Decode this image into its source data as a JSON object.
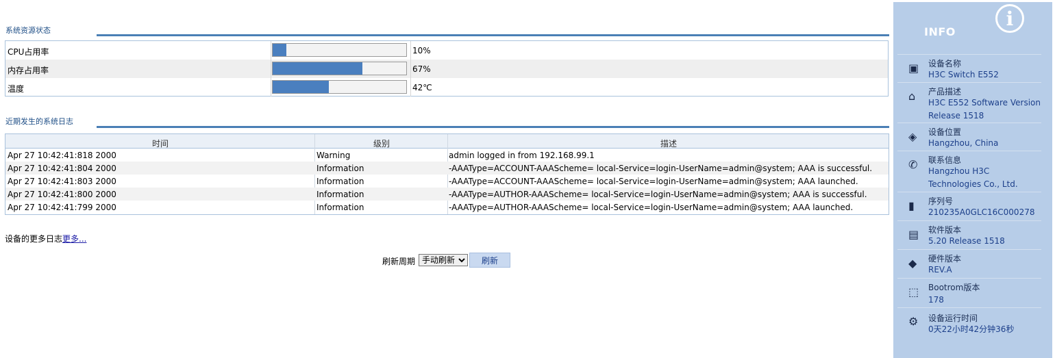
{
  "resource": {
    "title": "系统资源状态",
    "rows": [
      {
        "label": "CPU占用率",
        "value": "10%",
        "percent": 10
      },
      {
        "label": "内存占用率",
        "value": "67%",
        "percent": 67
      },
      {
        "label": "温度",
        "value": "42℃",
        "percent": 42
      }
    ]
  },
  "logs": {
    "title": "近期发生的系统日志",
    "headers": {
      "time": "时间",
      "level": "级别",
      "desc": "描述"
    },
    "rows": [
      {
        "time": "Apr 27 10:42:41:818 2000",
        "level": "Warning",
        "desc": "admin logged in from 192.168.99.1"
      },
      {
        "time": "Apr 27 10:42:41:804 2000",
        "level": "Information",
        "desc": "-AAAType=ACCOUNT-AAAScheme= local-Service=login-UserName=admin@system; AAA is successful."
      },
      {
        "time": "Apr 27 10:42:41:803 2000",
        "level": "Information",
        "desc": "-AAAType=ACCOUNT-AAAScheme= local-Service=login-UserName=admin@system; AAA launched."
      },
      {
        "time": "Apr 27 10:42:41:800 2000",
        "level": "Information",
        "desc": "-AAAType=AUTHOR-AAAScheme= local-Service=login-UserName=admin@system; AAA is successful."
      },
      {
        "time": "Apr 27 10:42:41:799 2000",
        "level": "Information",
        "desc": "-AAAType=AUTHOR-AAAScheme= local-Service=login-UserName=admin@system; AAA launched."
      }
    ],
    "more_prefix": "设备的更多日志",
    "more_link": "更多..."
  },
  "refresh": {
    "label": "刷新周期",
    "selected": "手动刷新",
    "button": "刷新"
  },
  "info": {
    "title": "INFO",
    "items": [
      {
        "icon": "switch-icon",
        "label": "设备名称",
        "value": "H3C Switch E552"
      },
      {
        "icon": "product-icon",
        "label": "产品描述",
        "value": "H3C E552 Software Version Release 1518"
      },
      {
        "icon": "location-icon",
        "label": "设备位置",
        "value": "Hangzhou, China"
      },
      {
        "icon": "contact-icon",
        "label": "联系信息",
        "value": "Hangzhou H3C Technologies Co., Ltd."
      },
      {
        "icon": "serial-icon",
        "label": "序列号",
        "value": "210235A0GLC16C000278"
      },
      {
        "icon": "software-icon",
        "label": "软件版本",
        "value": "5.20 Release 1518"
      },
      {
        "icon": "hardware-icon",
        "label": "硬件版本",
        "value": "REV.A"
      },
      {
        "icon": "bootrom-icon",
        "label": "Bootrom版本",
        "value": "178"
      },
      {
        "icon": "uptime-icon",
        "label": "设备运行时间",
        "value": "0天22小时42分钟36秒"
      }
    ]
  },
  "colors": {
    "accent": "#4a7fbf",
    "panel": "#b7cde8",
    "title": "#1e4e86"
  }
}
